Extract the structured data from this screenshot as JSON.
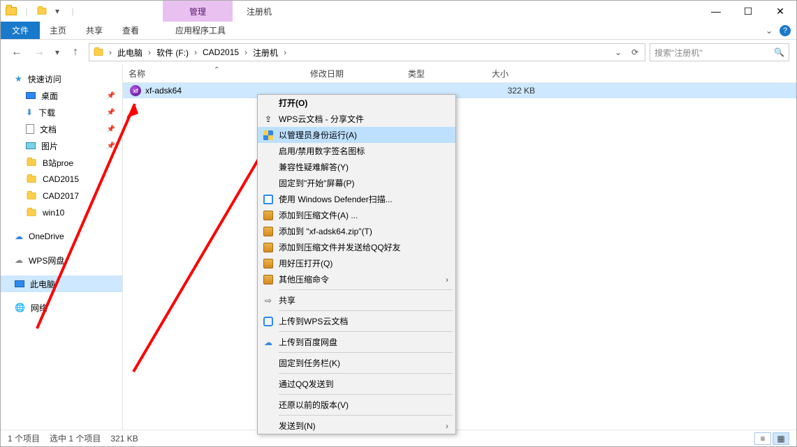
{
  "titlebar": {
    "manage_tab": "管理",
    "window_title": "注册机"
  },
  "ribbon": {
    "file": "文件",
    "tabs": [
      "主页",
      "共享",
      "查看"
    ],
    "tools_tab": "应用程序工具"
  },
  "nav": {
    "breadcrumb": [
      "此电脑",
      "软件 (F:)",
      "CAD2015",
      "注册机"
    ],
    "search_placeholder": "搜索\"注册机\""
  },
  "sidebar": {
    "quick_access": "快速访问",
    "items_pinned": [
      {
        "label": "桌面"
      },
      {
        "label": "下载"
      },
      {
        "label": "文档"
      },
      {
        "label": "图片"
      }
    ],
    "items_recent": [
      {
        "label": "B站proe"
      },
      {
        "label": "CAD2015"
      },
      {
        "label": "CAD2017"
      },
      {
        "label": "win10"
      }
    ],
    "onedrive": "OneDrive",
    "wps": "WPS网盘",
    "this_pc": "此电脑",
    "network": "网络"
  },
  "columns": {
    "name": "名称",
    "date": "修改日期",
    "type": "类型",
    "size": "大小"
  },
  "files": [
    {
      "name": "xf-adsk64",
      "size": "322 KB"
    }
  ],
  "context_menu": {
    "open": "打开(O)",
    "wps_share": "WPS云文档 - 分享文件",
    "run_admin": "以管理员身份运行(A)",
    "toggle_sig": "启用/禁用数字签名图标",
    "compat": "兼容性疑难解答(Y)",
    "pin_start": "固定到\"开始\"屏幕(P)",
    "defender": "使用 Windows Defender扫描...",
    "add_zip": "添加到压缩文件(A) ...",
    "add_zip_named": "添加到 \"xf-adsk64.zip\"(T)",
    "zip_send_qq": "添加到压缩文件并发送给QQ好友",
    "open_haozip": "用好压打开(Q)",
    "other_zip": "其他压缩命令",
    "share": "共享",
    "upload_wps": "上传到WPS云文档",
    "upload_baidu": "上传到百度网盘",
    "pin_taskbar": "固定到任务栏(K)",
    "send_qq": "通过QQ发送到",
    "restore": "还原以前的版本(V)",
    "send_to": "发送到(N)"
  },
  "status": {
    "count": "1 个项目",
    "selected": "选中 1 个项目",
    "size": "321 KB"
  }
}
